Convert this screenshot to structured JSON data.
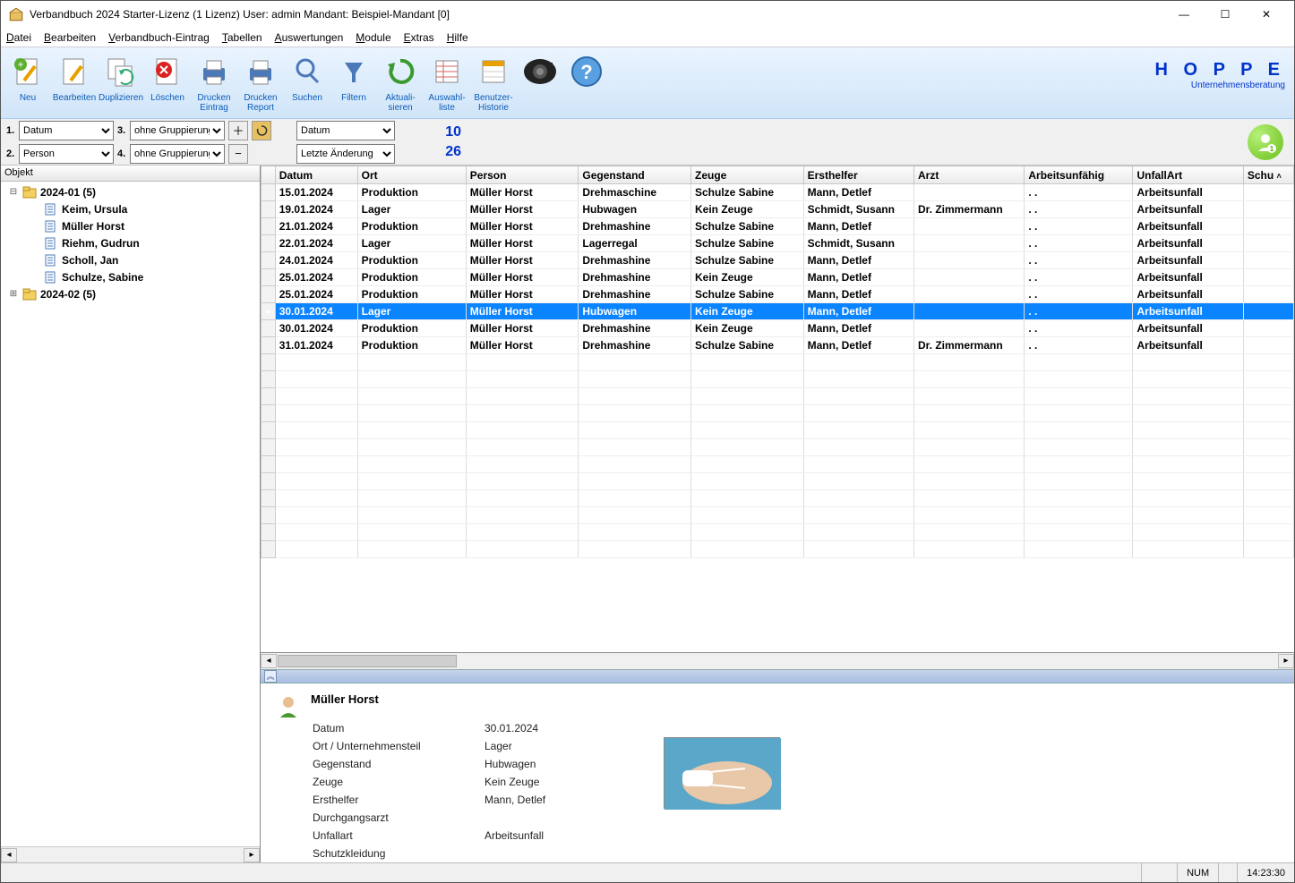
{
  "window": {
    "title": "Verbandbuch 2024 Starter-Lizenz (1 Lizenz)    User: admin Mandant: Beispiel-Mandant [0]"
  },
  "menu": [
    "Datei",
    "Bearbeiten",
    "Verbandbuch-Eintrag",
    "Tabellen",
    "Auswertungen",
    "Module",
    "Extras",
    "Hilfe"
  ],
  "toolbar": [
    {
      "label": "Neu"
    },
    {
      "label": "Bearbeiten"
    },
    {
      "label": "Duplizieren"
    },
    {
      "label": "Löschen"
    },
    {
      "label": "Drucken Eintrag"
    },
    {
      "label": "Drucken Report"
    },
    {
      "label": "Suchen"
    },
    {
      "label": "Filtern"
    },
    {
      "label": "Aktuali-\nsieren"
    },
    {
      "label": "Auswahl-\nliste"
    },
    {
      "label": "Benutzer-\nHistorie"
    },
    {
      "label": ""
    }
  ],
  "logo": {
    "big": "H O P P E",
    "small": "Unternehmensberatung"
  },
  "filter": {
    "g1": {
      "n": "1.",
      "v": "Datum"
    },
    "g2": {
      "n": "2.",
      "v": "Person"
    },
    "g3": {
      "n": "3.",
      "v": "ohne Gruppierung"
    },
    "g4": {
      "n": "4.",
      "v": "ohne Gruppierung"
    },
    "sort1": "Datum",
    "sort2": "Letzte Änderung",
    "count1": "10",
    "count2": "26"
  },
  "tree": {
    "header": "Objekt",
    "nodes": [
      {
        "type": "folder",
        "exp": "⊟",
        "label": "2024-01  (5)",
        "bold": true
      },
      {
        "type": "item",
        "label": "Keim, Ursula",
        "bold": true
      },
      {
        "type": "item",
        "label": "Müller Horst",
        "bold": true
      },
      {
        "type": "item",
        "label": "Riehm, Gudrun",
        "bold": true
      },
      {
        "type": "item",
        "label": "Scholl, Jan",
        "bold": true
      },
      {
        "type": "item",
        "label": "Schulze, Sabine",
        "bold": true
      },
      {
        "type": "folder",
        "exp": "⊞",
        "label": "2024-02  (5)",
        "bold": true
      }
    ]
  },
  "grid": {
    "columns": [
      "Datum",
      "Ort",
      "Person",
      "Gegenstand",
      "Zeuge",
      "Ersthelfer",
      "Arzt",
      "Arbeitsunfähig",
      "UnfallArt",
      "Schu"
    ],
    "rows": [
      [
        "15.01.2024",
        "Produktion",
        "Müller Horst",
        "Drehmaschine",
        "Schulze Sabine",
        "Mann, Detlef",
        "",
        ".  .",
        "Arbeitsunfall"
      ],
      [
        "19.01.2024",
        "Lager",
        "Müller Horst",
        "Hubwagen",
        "Kein Zeuge",
        "Schmidt, Susann",
        "Dr. Zimmermann",
        ".  .",
        "Arbeitsunfall"
      ],
      [
        "21.01.2024",
        "Produktion",
        "Müller Horst",
        "Drehmashine",
        "Schulze Sabine",
        "Mann, Detlef",
        "",
        ".  .",
        "Arbeitsunfall"
      ],
      [
        "22.01.2024",
        "Lager",
        "Müller Horst",
        "Lagerregal",
        "Schulze Sabine",
        "Schmidt, Susann",
        "",
        ".  .",
        "Arbeitsunfall"
      ],
      [
        "24.01.2024",
        "Produktion",
        "Müller Horst",
        "Drehmashine",
        "Schulze Sabine",
        "Mann, Detlef",
        "",
        ".  .",
        "Arbeitsunfall"
      ],
      [
        "25.01.2024",
        "Produktion",
        "Müller Horst",
        "Drehmashine",
        "Kein Zeuge",
        "Mann, Detlef",
        "",
        ".  .",
        "Arbeitsunfall"
      ],
      [
        "25.01.2024",
        "Produktion",
        "Müller Horst",
        "Drehmashine",
        "Schulze Sabine",
        "Mann, Detlef",
        "",
        ".  .",
        "Arbeitsunfall"
      ],
      [
        "30.01.2024",
        "Lager",
        "Müller Horst",
        "Hubwagen",
        "Kein Zeuge",
        "Mann, Detlef",
        "",
        ".  .",
        "Arbeitsunfall"
      ],
      [
        "30.01.2024",
        "Produktion",
        "Müller Horst",
        "Drehmashine",
        "Kein Zeuge",
        "Mann, Detlef",
        "",
        ".  .",
        "Arbeitsunfall"
      ],
      [
        "31.01.2024",
        "Produktion",
        "Müller Horst",
        "Drehmashine",
        "Schulze Sabine",
        "Mann, Detlef",
        "Dr. Zimmermann",
        ".  .",
        "Arbeitsunfall"
      ]
    ],
    "selected": 7,
    "emptyRows": 12
  },
  "detail": {
    "name": "Müller Horst",
    "fields": [
      [
        "Datum",
        "30.01.2024"
      ],
      [
        "Ort / Unternehmensteil",
        "Lager"
      ],
      [
        "Gegenstand",
        "Hubwagen"
      ],
      [
        "Zeuge",
        "Kein Zeuge"
      ],
      [
        "Ersthelfer",
        "Mann, Detlef"
      ],
      [
        "Durchgangsarzt",
        ""
      ],
      [
        "Unfallart",
        "Arbeitsunfall"
      ],
      [
        "Schutzkleidung",
        ""
      ]
    ]
  },
  "status": {
    "num": "NUM",
    "time": "14:23:30"
  }
}
